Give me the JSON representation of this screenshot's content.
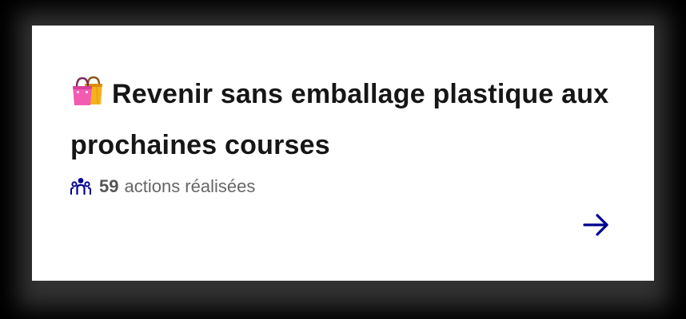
{
  "card": {
    "emoji_icon": "shopping-bags-icon",
    "title": "Revenir sans emballage plastique aux prochaines courses",
    "stats": {
      "icon": "people-icon",
      "count": "59",
      "label": "actions réalisées"
    },
    "cta_icon": "arrow-right-icon"
  },
  "colors": {
    "accent": "#000091",
    "title": "#161616",
    "meta": "#666666",
    "card_bg": "#ffffff"
  }
}
